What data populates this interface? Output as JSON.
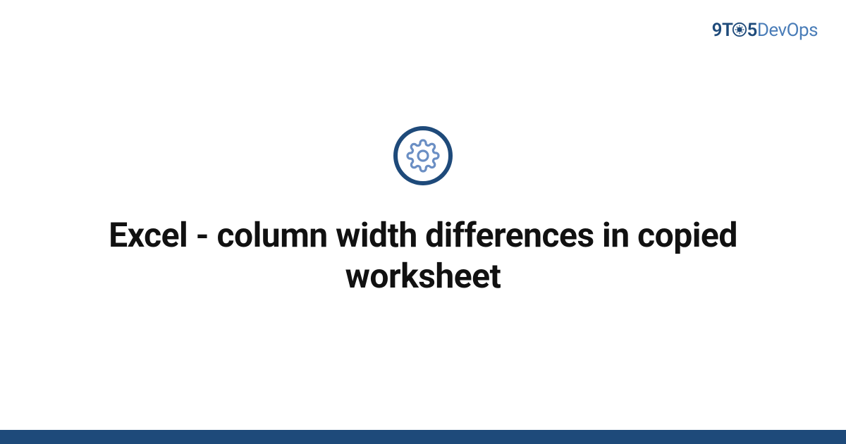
{
  "logo": {
    "part1": "9T",
    "part2": "5",
    "part3": "DevOps"
  },
  "title": "Excel - column width differences in copied worksheet",
  "colors": {
    "primary": "#1e4a7a",
    "secondary": "#4a7db8",
    "gearLight": "#6b8fc4"
  }
}
